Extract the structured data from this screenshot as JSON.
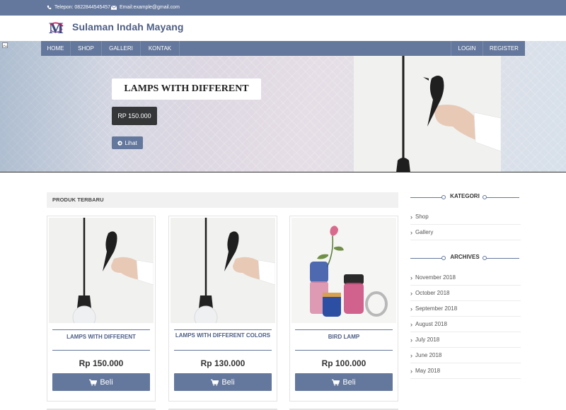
{
  "topbar": {
    "phone": "Telepon: 0822844545457",
    "email": "Email:example@gmail.com"
  },
  "header": {
    "brand": "Sulaman Indah Mayang"
  },
  "nav": {
    "items": [
      "HOME",
      "SHOP",
      "GALLERI",
      "KONTAK"
    ],
    "login": "LOGIN",
    "register": "REGISTER"
  },
  "hero": {
    "title": "LAMPS WITH DIFFERENT",
    "price": "RP 150.000",
    "button": "Lihat"
  },
  "products_section": {
    "title": "PRODUK TERBARU",
    "items": [
      {
        "name": "LAMPS WITH DIFFERENT",
        "price": "Rp 150.000",
        "button": "Beli"
      },
      {
        "name": "LAMPS WITH DIFFERENT COLORS",
        "price": "Rp 130.000",
        "button": "Beli"
      },
      {
        "name": "BIRD LAMP",
        "price": "Rp 100.000",
        "button": "Beli"
      }
    ]
  },
  "sidebar": {
    "categories_title": "KATEGORI",
    "categories": [
      "Shop",
      "Gallery"
    ],
    "archives_title": "ARCHIVES",
    "archives": [
      "November 2018",
      "October 2018",
      "September 2018",
      "August 2018",
      "July 2018",
      "June 2018",
      "May 2018"
    ]
  },
  "colors": {
    "accent": "#64779c",
    "brand_text": "#4d5e85",
    "price_badge": "#353638"
  }
}
